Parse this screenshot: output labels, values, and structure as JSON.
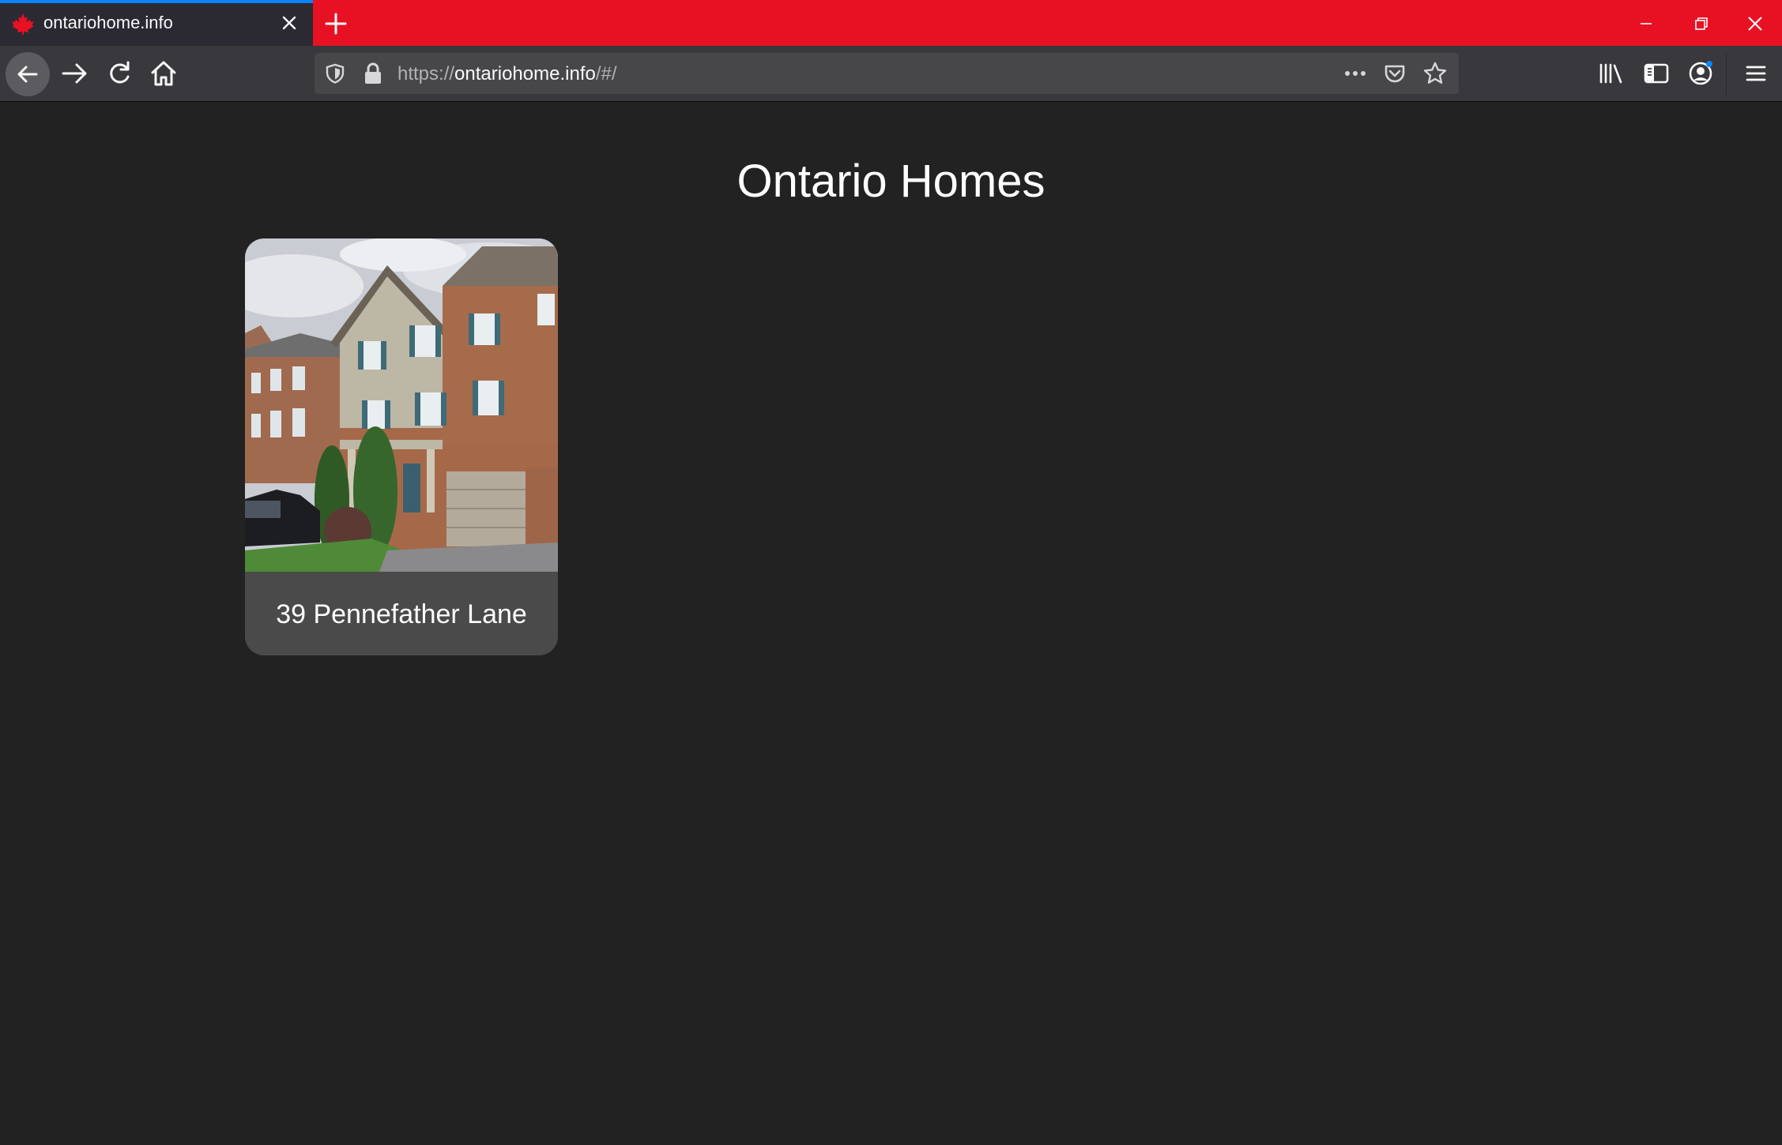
{
  "browser": {
    "tab": {
      "title": "ontariohome.info",
      "favicon": "maple-leaf-icon",
      "close_icon": "close-icon"
    },
    "new_tab_icon": "plus-icon",
    "window_controls": [
      "minimize-icon",
      "restore-icon",
      "close-icon"
    ],
    "nav": {
      "back_icon": "back-arrow-icon",
      "forward_icon": "forward-arrow-icon",
      "reload_icon": "reload-icon",
      "home_icon": "home-icon"
    },
    "url": {
      "scheme": "https://",
      "host": "ontariohome.info",
      "path": "/#/"
    },
    "url_icons": [
      "shield-icon",
      "lock-icon",
      "more-icon",
      "pocket-icon",
      "star-icon"
    ],
    "toolbar_icons": [
      "library-icon",
      "sidebar-icon",
      "account-icon",
      "menu-icon"
    ],
    "colors": {
      "tabstrip": "#e81123",
      "tab_progress": "#0a84ff",
      "toolbar": "#38383d",
      "urlbar": "#474749"
    }
  },
  "page": {
    "title": "Ontario Homes",
    "background": "#222222",
    "listings": [
      {
        "address": "39 Pennefather Lane",
        "image": "townhouse-photo"
      }
    ]
  }
}
